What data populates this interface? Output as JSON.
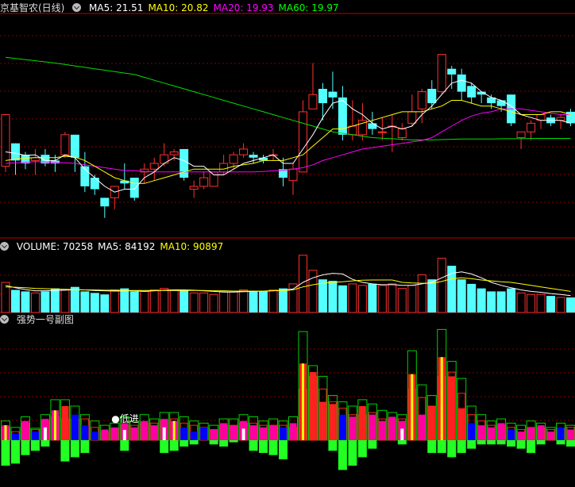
{
  "stock": {
    "name": "京基智农(日线)"
  },
  "main_panel": {
    "ma_labels": [
      {
        "text": "MA5: 21.51",
        "color": "#ffffff"
      },
      {
        "text": "MA10: 20.82",
        "color": "#ffff00"
      },
      {
        "text": "MA20: 19.93",
        "color": "#ff00ff"
      },
      {
        "text": "MA60: 19.97",
        "color": "#00ff00"
      }
    ]
  },
  "volume_panel": {
    "labels": [
      {
        "text": "VOLUME: 70258",
        "color": "#ffffff"
      },
      {
        "text": "MA5: 84192",
        "color": "#ffffff"
      },
      {
        "text": "MA10: 90897",
        "color": "#ffff00"
      }
    ]
  },
  "indicator_panel": {
    "title": "强势一号副图",
    "signal_text": "低进"
  },
  "colors": {
    "up": "#ff3030",
    "down": "#54ffff",
    "grid": "#800000"
  },
  "chart_data": {
    "type": "candlestick",
    "ohlc": [
      [
        19.0,
        20.8,
        18.8,
        20.8
      ],
      [
        19.8,
        19.8,
        18.7,
        19.2
      ],
      [
        19.4,
        19.5,
        18.9,
        19.1
      ],
      [
        19.2,
        19.6,
        18.7,
        19.3
      ],
      [
        19.4,
        19.6,
        19.0,
        19.1
      ],
      [
        19.2,
        19.4,
        18.8,
        19.1
      ],
      [
        19.4,
        20.2,
        19.3,
        20.1
      ],
      [
        20.1,
        20.1,
        18.8,
        19.3
      ],
      [
        19.0,
        19.5,
        18.1,
        18.3
      ],
      [
        18.6,
        18.7,
        18.0,
        18.2
      ],
      [
        17.9,
        17.9,
        17.2,
        17.6
      ],
      [
        17.9,
        18.3,
        17.5,
        18.3
      ],
      [
        18.5,
        19.1,
        18.2,
        18.4
      ],
      [
        18.6,
        18.6,
        17.8,
        17.9
      ],
      [
        18.8,
        19.1,
        18.4,
        18.9
      ],
      [
        18.9,
        19.3,
        18.5,
        19.1
      ],
      [
        19.1,
        19.8,
        19.0,
        19.4
      ],
      [
        19.4,
        19.6,
        19.2,
        19.5
      ],
      [
        19.6,
        19.6,
        18.5,
        18.6
      ],
      [
        18.2,
        18.5,
        17.9,
        18.3
      ],
      [
        18.3,
        18.8,
        18.2,
        18.6
      ],
      [
        18.3,
        18.8,
        18.3,
        18.8
      ],
      [
        18.8,
        19.4,
        18.7,
        19.1
      ],
      [
        19.1,
        19.5,
        18.9,
        19.4
      ],
      [
        19.4,
        19.8,
        19.3,
        19.6
      ],
      [
        19.4,
        19.5,
        19.1,
        19.3
      ],
      [
        19.3,
        19.4,
        19.1,
        19.2
      ],
      [
        19.4,
        19.6,
        19.2,
        19.4
      ],
      [
        18.9,
        19.3,
        18.3,
        18.6
      ],
      [
        18.5,
        19.1,
        18.0,
        18.9
      ],
      [
        18.8,
        21.3,
        18.8,
        20.9
      ],
      [
        21.0,
        22.6,
        21.0,
        21.5
      ],
      [
        21.7,
        21.9,
        20.6,
        21.2
      ],
      [
        21.6,
        22.3,
        21.0,
        21.4
      ],
      [
        21.4,
        21.8,
        19.9,
        20.1
      ],
      [
        20.1,
        21.3,
        19.9,
        20.4
      ],
      [
        20.1,
        21.2,
        19.9,
        20.6
      ],
      [
        20.5,
        20.9,
        20.1,
        20.3
      ],
      [
        20.2,
        20.7,
        19.9,
        20.2
      ],
      [
        20.4,
        20.8,
        19.5,
        20.4
      ],
      [
        20.0,
        20.5,
        19.9,
        20.3
      ],
      [
        20.5,
        21.5,
        20.4,
        20.9
      ],
      [
        21.0,
        21.7,
        20.5,
        21.6
      ],
      [
        21.7,
        22.0,
        21.0,
        21.2
      ],
      [
        21.6,
        22.9,
        21.5,
        22.9
      ],
      [
        22.4,
        22.5,
        21.7,
        22.2
      ],
      [
        22.2,
        22.4,
        21.3,
        21.6
      ],
      [
        21.8,
        21.9,
        21.2,
        21.4
      ],
      [
        21.6,
        21.6,
        21.2,
        21.5
      ],
      [
        21.4,
        21.5,
        21.0,
        21.2
      ],
      [
        21.3,
        21.3,
        20.9,
        21.1
      ],
      [
        21.5,
        21.5,
        20.4,
        20.5
      ],
      [
        20.0,
        20.2,
        19.6,
        20.2
      ],
      [
        20.2,
        20.6,
        19.9,
        20.5
      ],
      [
        20.6,
        20.8,
        20.3,
        20.8
      ],
      [
        20.7,
        20.8,
        20.4,
        20.5
      ],
      [
        20.6,
        20.8,
        20.3,
        20.7
      ],
      [
        20.9,
        21.0,
        20.4,
        20.5
      ]
    ],
    "ma5": [
      19.5,
      19.45,
      19.38,
      19.4,
      19.2,
      19.2,
      19.4,
      19.3,
      18.9,
      18.6,
      18.3,
      18.1,
      18.2,
      18.2,
      18.6,
      18.8,
      19.1,
      19.3,
      19.2,
      19.0,
      19.0,
      18.7,
      18.7,
      18.9,
      19.1,
      19.2,
      19.3,
      19.4,
      19.1,
      19.1,
      19.6,
      20.1,
      20.7,
      21.2,
      21.3,
      21.0,
      20.8,
      20.5,
      20.3,
      20.4,
      20.3,
      20.4,
      20.8,
      21.1,
      21.5,
      21.9,
      22.0,
      21.9,
      21.6,
      21.4,
      21.3,
      21.1,
      20.8,
      20.7,
      20.6,
      20.6,
      20.6,
      20.5
    ],
    "ma10": [
      19.2,
      19.25,
      19.28,
      19.3,
      19.3,
      19.3,
      19.35,
      19.32,
      19.2,
      19.0,
      18.8,
      18.6,
      18.5,
      18.4,
      18.4,
      18.5,
      18.6,
      18.7,
      18.8,
      18.9,
      18.9,
      18.9,
      18.9,
      19.0,
      19.05,
      19.1,
      19.2,
      19.2,
      19.2,
      19.3,
      19.4,
      19.7,
      20.0,
      20.3,
      20.3,
      20.4,
      20.5,
      20.6,
      20.7,
      20.8,
      20.9,
      20.9,
      20.9,
      21.0,
      21.1,
      21.3,
      21.3,
      21.2,
      21.1,
      21.1,
      21.0,
      20.9,
      20.8,
      20.8,
      20.8,
      20.9,
      20.9,
      20.8
    ],
    "ma20": [
      19.1,
      19.12,
      19.14,
      19.16,
      19.15,
      19.14,
      19.12,
      19.1,
      19.05,
      19.0,
      18.95,
      18.9,
      18.85,
      18.85,
      18.82,
      18.8,
      18.8,
      18.8,
      18.8,
      18.8,
      18.8,
      18.8,
      18.8,
      18.8,
      18.8,
      18.8,
      18.82,
      18.84,
      18.86,
      18.9,
      18.95,
      19.05,
      19.2,
      19.3,
      19.4,
      19.5,
      19.6,
      19.65,
      19.7,
      19.75,
      19.8,
      19.85,
      19.9,
      20.0,
      20.2,
      20.4,
      20.6,
      20.75,
      20.85,
      20.9,
      21.0,
      21.0,
      21.0,
      20.95,
      20.9,
      20.85,
      20.8,
      20.8
    ],
    "ma60": [
      22.8,
      22.76,
      22.72,
      22.68,
      22.64,
      22.6,
      22.55,
      22.5,
      22.45,
      22.4,
      22.35,
      22.3,
      22.25,
      22.2,
      22.1,
      22.0,
      21.9,
      21.8,
      21.7,
      21.6,
      21.5,
      21.4,
      21.3,
      21.2,
      21.1,
      21.0,
      20.9,
      20.8,
      20.7,
      20.6,
      20.5,
      20.4,
      20.3,
      20.2,
      20.15,
      20.1,
      20.05,
      20.0,
      19.98,
      19.96,
      19.94,
      19.92,
      19.92,
      19.92,
      19.93,
      19.94,
      19.95,
      19.95,
      19.95,
      19.95,
      19.96,
      19.96,
      19.96,
      19.97,
      19.97,
      19.97,
      19.97,
      19.97
    ],
    "volume": [
      100000,
      75000,
      70000,
      65000,
      70000,
      80000,
      75000,
      85000,
      70000,
      65000,
      60000,
      75000,
      80000,
      70000,
      70000,
      75000,
      80000,
      75000,
      75000,
      65000,
      65000,
      60000,
      70000,
      70000,
      75000,
      70000,
      70000,
      75000,
      80000,
      95000,
      190000,
      140000,
      110000,
      105000,
      90000,
      95000,
      90000,
      95000,
      90000,
      95000,
      80000,
      90000,
      125000,
      110000,
      180000,
      155000,
      110000,
      95000,
      80000,
      70000,
      70000,
      80000,
      65000,
      60000,
      60000,
      55000,
      50000,
      50000
    ],
    "vol_ma5": [
      90000,
      82000,
      76000,
      72000,
      72000,
      73000,
      74000,
      76000,
      75000,
      73000,
      72000,
      71000,
      72000,
      72000,
      70000,
      72000,
      74000,
      75000,
      75000,
      74000,
      72000,
      70000,
      68000,
      68000,
      69000,
      70000,
      71000,
      72000,
      74000,
      78000,
      100000,
      115000,
      125000,
      130000,
      128000,
      110000,
      100000,
      95000,
      92000,
      93000,
      90000,
      90000,
      95000,
      100000,
      115000,
      130000,
      135000,
      128000,
      115000,
      100000,
      90000,
      82000,
      75000,
      70000,
      67000,
      63000,
      60000,
      56000
    ],
    "vol_ma10": [
      85000,
      84000,
      82000,
      80000,
      79000,
      78000,
      77000,
      76000,
      75000,
      75000,
      74000,
      74000,
      73000,
      73000,
      73000,
      73000,
      73000,
      73000,
      73000,
      73000,
      73000,
      72000,
      72000,
      71000,
      71000,
      71000,
      71000,
      72000,
      73000,
      75000,
      85000,
      92000,
      97000,
      100000,
      102000,
      105000,
      107000,
      108000,
      108000,
      108000,
      100000,
      98000,
      97000,
      97000,
      103000,
      112000,
      115000,
      112000,
      108000,
      105000,
      102000,
      100000,
      95000,
      90000,
      85000,
      80000,
      75000,
      70000
    ],
    "indicator": [
      [
        0.35,
        0.3,
        0.45,
        0,
        1
      ],
      [
        0.15,
        0.2,
        0.3,
        1,
        0
      ],
      [
        0.45,
        0.4,
        0.55,
        0,
        0
      ],
      [
        0.2,
        0.25,
        0.28,
        1,
        0
      ],
      [
        0.5,
        0.45,
        0.6,
        0,
        0
      ],
      [
        0.7,
        0.55,
        0.95,
        0,
        1
      ],
      [
        0.8,
        0.5,
        0.95,
        0,
        0
      ],
      [
        0.6,
        0.5,
        0.8,
        1,
        0
      ],
      [
        0.35,
        0.5,
        0.6,
        1,
        0
      ],
      [
        0.2,
        0.3,
        0.45,
        1,
        0
      ],
      [
        0.25,
        0.2,
        0.35,
        0,
        0
      ],
      [
        0.3,
        0.28,
        0.4,
        0,
        0
      ],
      [
        0.4,
        0.35,
        0.55,
        0,
        0
      ],
      [
        0.3,
        0.35,
        0.45,
        0,
        0
      ],
      [
        0.45,
        0.4,
        0.6,
        0,
        0
      ],
      [
        0.35,
        0.4,
        0.5,
        0,
        0
      ],
      [
        0.5,
        0.45,
        0.65,
        0,
        0
      ],
      [
        0.45,
        0.5,
        0.65,
        0,
        1
      ],
      [
        0.3,
        0.4,
        0.55,
        1,
        0
      ],
      [
        0.2,
        0.35,
        0.45,
        1,
        0
      ],
      [
        0.3,
        0.3,
        0.4,
        1,
        0
      ],
      [
        0.25,
        0.25,
        0.35,
        0,
        0
      ],
      [
        0.4,
        0.35,
        0.5,
        0,
        0
      ],
      [
        0.35,
        0.35,
        0.5,
        0,
        0
      ],
      [
        0.45,
        0.4,
        0.6,
        0,
        0
      ],
      [
        0.35,
        0.4,
        0.55,
        0,
        0
      ],
      [
        0.3,
        0.35,
        0.45,
        0,
        0
      ],
      [
        0.35,
        0.35,
        0.5,
        0,
        0
      ],
      [
        0.3,
        0.35,
        0.45,
        1,
        0
      ],
      [
        0.4,
        0.3,
        0.55,
        0,
        0
      ],
      [
        1.8,
        1.2,
        2.55,
        0,
        1
      ],
      [
        1.6,
        1.5,
        1.75,
        0,
        0
      ],
      [
        0.9,
        1.2,
        1.5,
        0,
        0
      ],
      [
        0.85,
        0.9,
        1.05,
        0,
        0
      ],
      [
        0.6,
        0.75,
        0.9,
        1,
        0
      ],
      [
        0.55,
        0.6,
        0.8,
        0,
        0
      ],
      [
        0.8,
        0.6,
        0.95,
        1,
        0
      ],
      [
        0.6,
        0.65,
        0.85,
        0,
        0
      ],
      [
        0.45,
        0.5,
        0.7,
        0,
        0
      ],
      [
        0.55,
        0.5,
        0.65,
        0,
        0
      ],
      [
        0.45,
        0.5,
        0.6,
        0,
        0
      ],
      [
        1.55,
        1.2,
        2.1,
        0,
        1
      ],
      [
        0.6,
        1.0,
        1.3,
        0,
        0
      ],
      [
        0.8,
        0.8,
        1.05,
        0,
        0
      ],
      [
        1.95,
        1.5,
        2.6,
        0,
        1
      ],
      [
        1.5,
        1.6,
        1.85,
        0,
        0
      ],
      [
        0.75,
        1.1,
        1.45,
        1,
        0
      ],
      [
        0.4,
        0.6,
        0.8,
        1,
        0
      ],
      [
        0.35,
        0.45,
        0.6,
        0,
        0
      ],
      [
        0.3,
        0.35,
        0.45,
        0,
        0
      ],
      [
        0.4,
        0.35,
        0.5,
        0,
        0
      ],
      [
        0.25,
        0.3,
        0.4,
        1,
        0
      ],
      [
        0.2,
        0.25,
        0.35,
        0,
        0
      ],
      [
        0.3,
        0.3,
        0.45,
        0,
        0
      ],
      [
        0.35,
        0.3,
        0.4,
        0,
        0
      ],
      [
        0.2,
        0.25,
        0.3,
        0,
        0
      ],
      [
        0.3,
        0.28,
        0.4,
        1,
        0
      ],
      [
        0.25,
        0.3,
        0.35,
        0,
        0
      ]
    ],
    "indicator_low": [
      0.6,
      0.55,
      0.35,
      0.25,
      0.15,
      0,
      0.5,
      0.4,
      0.3,
      0,
      0,
      0,
      0.25,
      0,
      0,
      0,
      0.3,
      0.25,
      0.15,
      0.1,
      0,
      0.1,
      0.15,
      0.05,
      0,
      0.25,
      0.3,
      0.35,
      0.45,
      0,
      0,
      0,
      0,
      0.25,
      0.7,
      0.6,
      0.4,
      0.2,
      0,
      0,
      0.1,
      0,
      0,
      0.3,
      0.3,
      0.4,
      0.3,
      0.2,
      0.1,
      0.1,
      0.1,
      0.15,
      0.2,
      0.3,
      0.1,
      0,
      0.1,
      0.15
    ],
    "signal_index": 11,
    "price_range": [
      16.5,
      24.3
    ],
    "volume_max": 200000,
    "indicator_range": [
      -1.1,
      2.7
    ]
  }
}
